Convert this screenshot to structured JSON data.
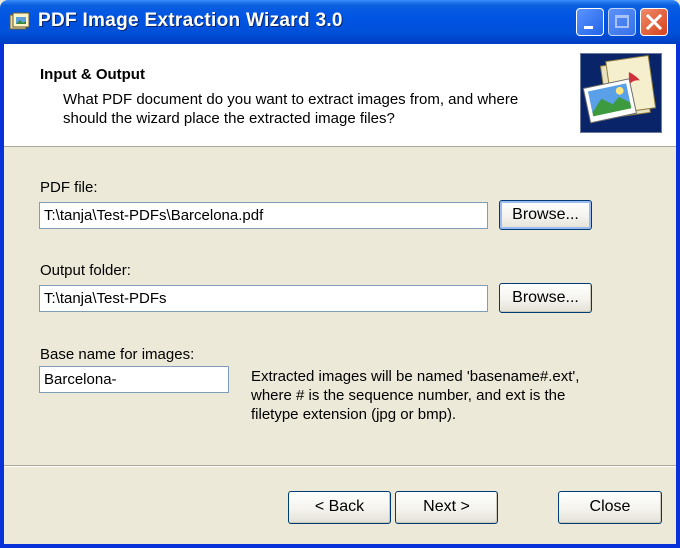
{
  "window": {
    "title": "PDF Image Extraction Wizard 3.0"
  },
  "header": {
    "title": "Input & Output",
    "description": "What PDF document do you want to extract images from, and where should the wizard place the extracted image files?"
  },
  "form": {
    "pdf_file_label": "PDF file:",
    "pdf_file_value": "T:\\tanja\\Test-PDFs\\Barcelona.pdf",
    "output_folder_label": "Output folder:",
    "output_folder_value": "T:\\tanja\\Test-PDFs",
    "base_name_label": "Base name for images:",
    "base_name_value": "Barcelona-",
    "browse_label": "Browse...",
    "note": "Extracted images will be named 'basename#.ext', where # is the sequence number, and ext is the filetype extension (jpg or bmp)."
  },
  "footer": {
    "back_label": "< Back",
    "next_label": "Next >",
    "close_label": "Close"
  }
}
